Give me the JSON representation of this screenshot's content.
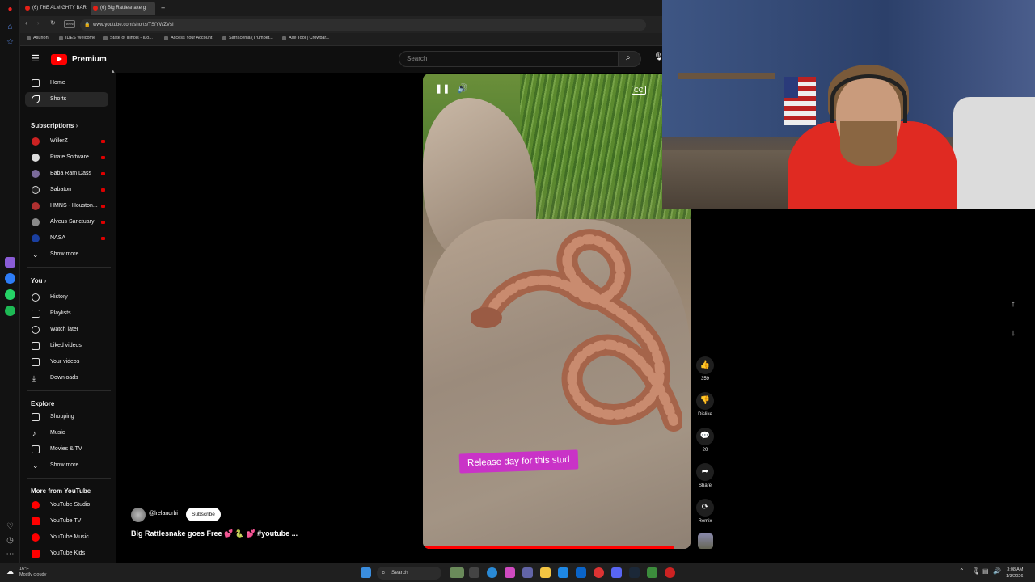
{
  "browser": {
    "tabs": [
      {
        "title": "(6) THE ALMIGHTY BAR"
      },
      {
        "title": "(6) Big Rattlesnake g"
      }
    ],
    "url": "www.youtube.com/shorts/TSfYWZVsI",
    "bookmarks": [
      "Asurion",
      "IDES Welcome",
      "State of Illinois - ILo...",
      "Access Your Account",
      "Sarracenia (Trumpet...",
      "Axe Tool | Crowbar..."
    ]
  },
  "youtube": {
    "brand": "Premium",
    "search_placeholder": "Search",
    "sidebar": {
      "home": "Home",
      "shorts": "Shorts",
      "subscriptions_heading": "Subscriptions",
      "subscriptions": [
        "WillerZ",
        "Pirate Software",
        "Baba Ram Dass",
        "Sabaton",
        "HMNS - Houston...",
        "Alveus Sanctuary",
        "NASA"
      ],
      "show_more_1": "Show more",
      "you_heading": "You",
      "you_items": [
        "History",
        "Playlists",
        "Watch later",
        "Liked videos",
        "Your videos",
        "Downloads"
      ],
      "explore_heading": "Explore",
      "explore_items": [
        "Shopping",
        "Music",
        "Movies & TV"
      ],
      "show_more_2": "Show more",
      "more_heading": "More from YouTube",
      "more_items": [
        "YouTube Studio",
        "YouTube TV",
        "YouTube Music",
        "YouTube Kids"
      ]
    },
    "video": {
      "caption": "Release day for this stud",
      "channel": "@lrelandrbi",
      "subscribe_label": "Subscribe",
      "title": "Big Rattlesnake goes Free 💕 🐍 💕 #youtube ..."
    },
    "actions": {
      "likes": "359",
      "dislike": "Dislike",
      "comments": "20",
      "share": "Share",
      "remix": "Remix"
    }
  },
  "taskbar": {
    "weather_temp": "16°F",
    "weather_desc": "Mostly cloudy",
    "search": "Search",
    "time": "3:08 AM",
    "date": "1/3/2026"
  }
}
